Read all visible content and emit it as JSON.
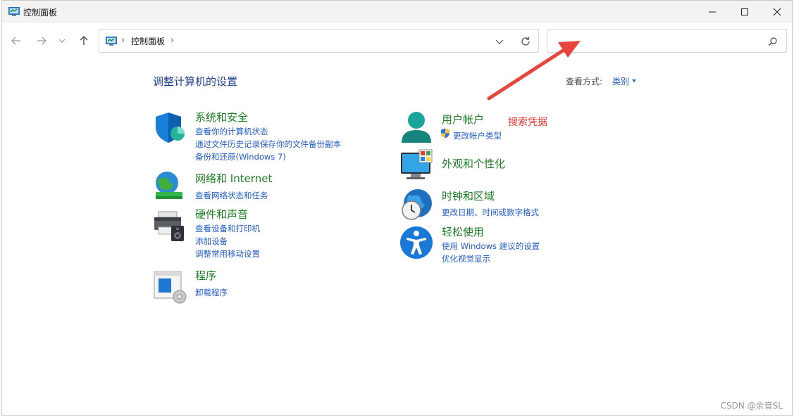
{
  "window": {
    "title": "控制面板",
    "icon": "control-panel-icon"
  },
  "nav": {
    "back_icon": "back-arrow-icon",
    "forward_icon": "forward-arrow-icon",
    "recent_icon": "chevron-down-icon",
    "up_icon": "up-arrow-icon",
    "address": {
      "segments": [
        "控制面板"
      ],
      "separator": "›"
    },
    "search": {
      "value": "",
      "placeholder": ""
    }
  },
  "main": {
    "heading": "调整计算机的设置",
    "view_by_label": "查看方式:",
    "view_by_value": "类别",
    "categories": [
      {
        "title": "系统和安全",
        "icon": "shield-icon",
        "links": [
          "查看你的计算机状态",
          "通过文件历史记录保存你的文件备份副本",
          "备份和还原(Windows 7)"
        ]
      },
      {
        "title": "网络和 Internet",
        "icon": "globe-network-icon",
        "links": [
          "查看网络状态和任务"
        ]
      },
      {
        "title": "硬件和声音",
        "icon": "printer-speaker-icon",
        "links": [
          "查看设备和打印机",
          "添加设备",
          "调整常用移动设置"
        ]
      },
      {
        "title": "程序",
        "icon": "programs-icon",
        "links": [
          "卸载程序"
        ]
      },
      {
        "title": "用户帐户",
        "icon": "user-icon",
        "links": [
          "更改帐户类型"
        ]
      },
      {
        "title": "外观和个性化",
        "icon": "monitor-palette-icon",
        "links": []
      },
      {
        "title": "时钟和区域",
        "icon": "clock-globe-icon",
        "links": [
          "更改日期、时间或数字格式"
        ]
      },
      {
        "title": "轻松使用",
        "icon": "accessibility-icon",
        "links": [
          "使用 Windows 建议的设置",
          "优化视觉显示"
        ]
      }
    ]
  },
  "annotation": {
    "text": "搜索凭据",
    "color": "#e53935"
  },
  "watermark": "CSDN @余音SL",
  "colors": {
    "title_green": "#1b7d22",
    "link_blue": "#1f5bc6",
    "heading_blue": "#1e3f8c"
  }
}
